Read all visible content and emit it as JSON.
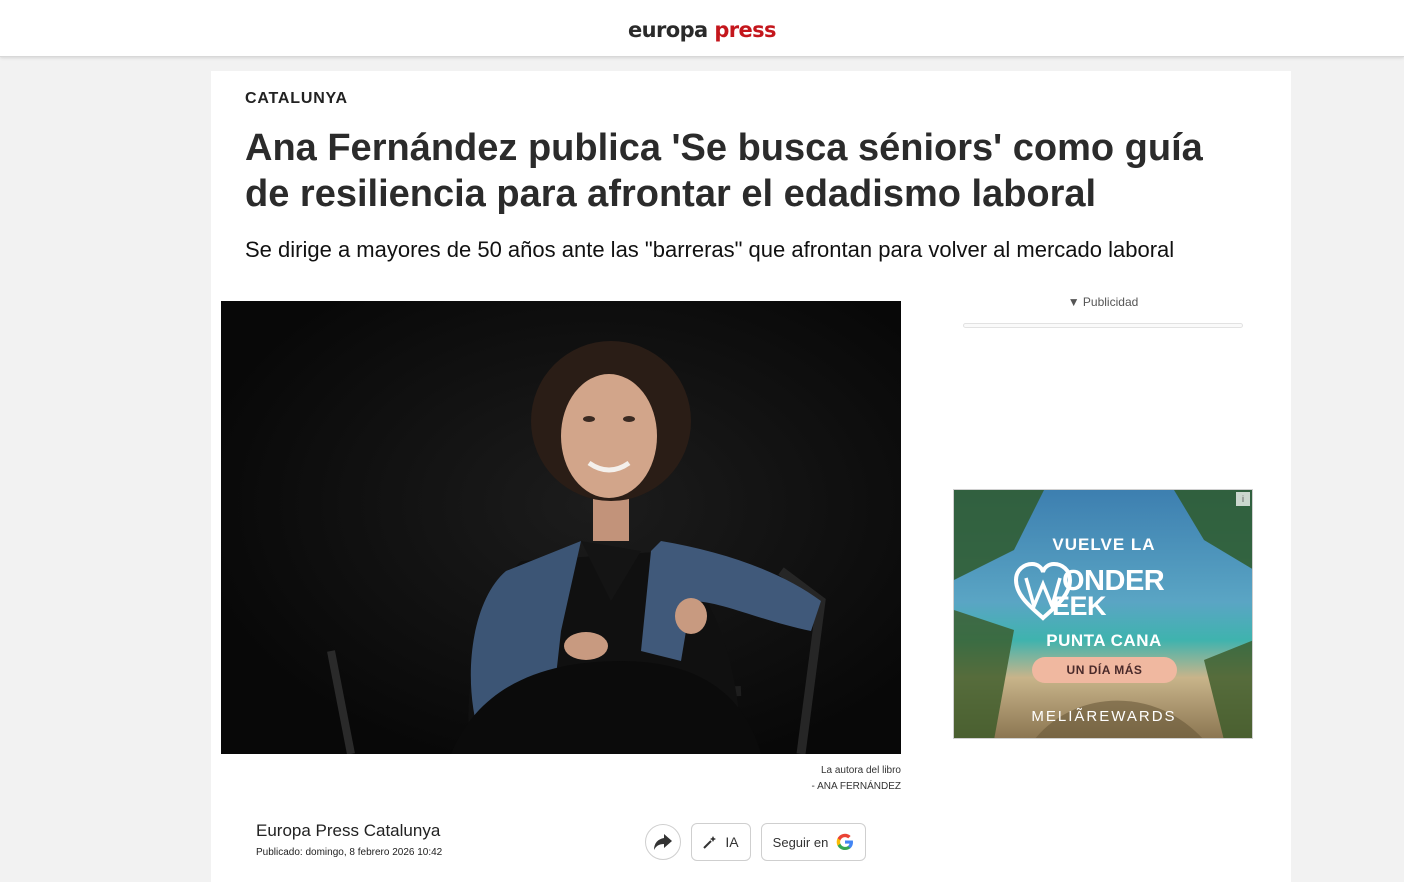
{
  "header": {
    "logo_part1": "europa",
    "logo_part2": "press",
    "logo_color_dark": "#2a2a2a",
    "logo_color_red": "#c4161c"
  },
  "article": {
    "section": "CATALUNYA",
    "headline": "Ana Fernández publica 'Se busca séniors' como guía de resiliencia para afrontar el edadismo laboral",
    "subheadline": "Se dirige a mayores de 50 años ante las \"barreras\" que afrontan para volver al mercado laboral",
    "caption_line1": "La autora del libro",
    "caption_line2": "- ANA FERNÁNDEZ",
    "author": "Europa Press Catalunya",
    "published": "Publicado: domingo, 8 febrero 2026 10:42"
  },
  "actions": {
    "share_icon": "share-arrow-icon",
    "ia_label": "IA",
    "ia_icon": "sparkle-icon",
    "follow_label": "Seguir en",
    "follow_icon": "google-icon"
  },
  "sidebar": {
    "ad_label": "▼ Publicidad"
  },
  "ad": {
    "line1": "VUELVE LA",
    "brand_word1": "ONDER",
    "brand_word2": "EEK",
    "line2": "PUNTA CANA",
    "cta": "UN DÍA MÁS",
    "footer": "MELIÃREWARDS",
    "corner": "i"
  }
}
